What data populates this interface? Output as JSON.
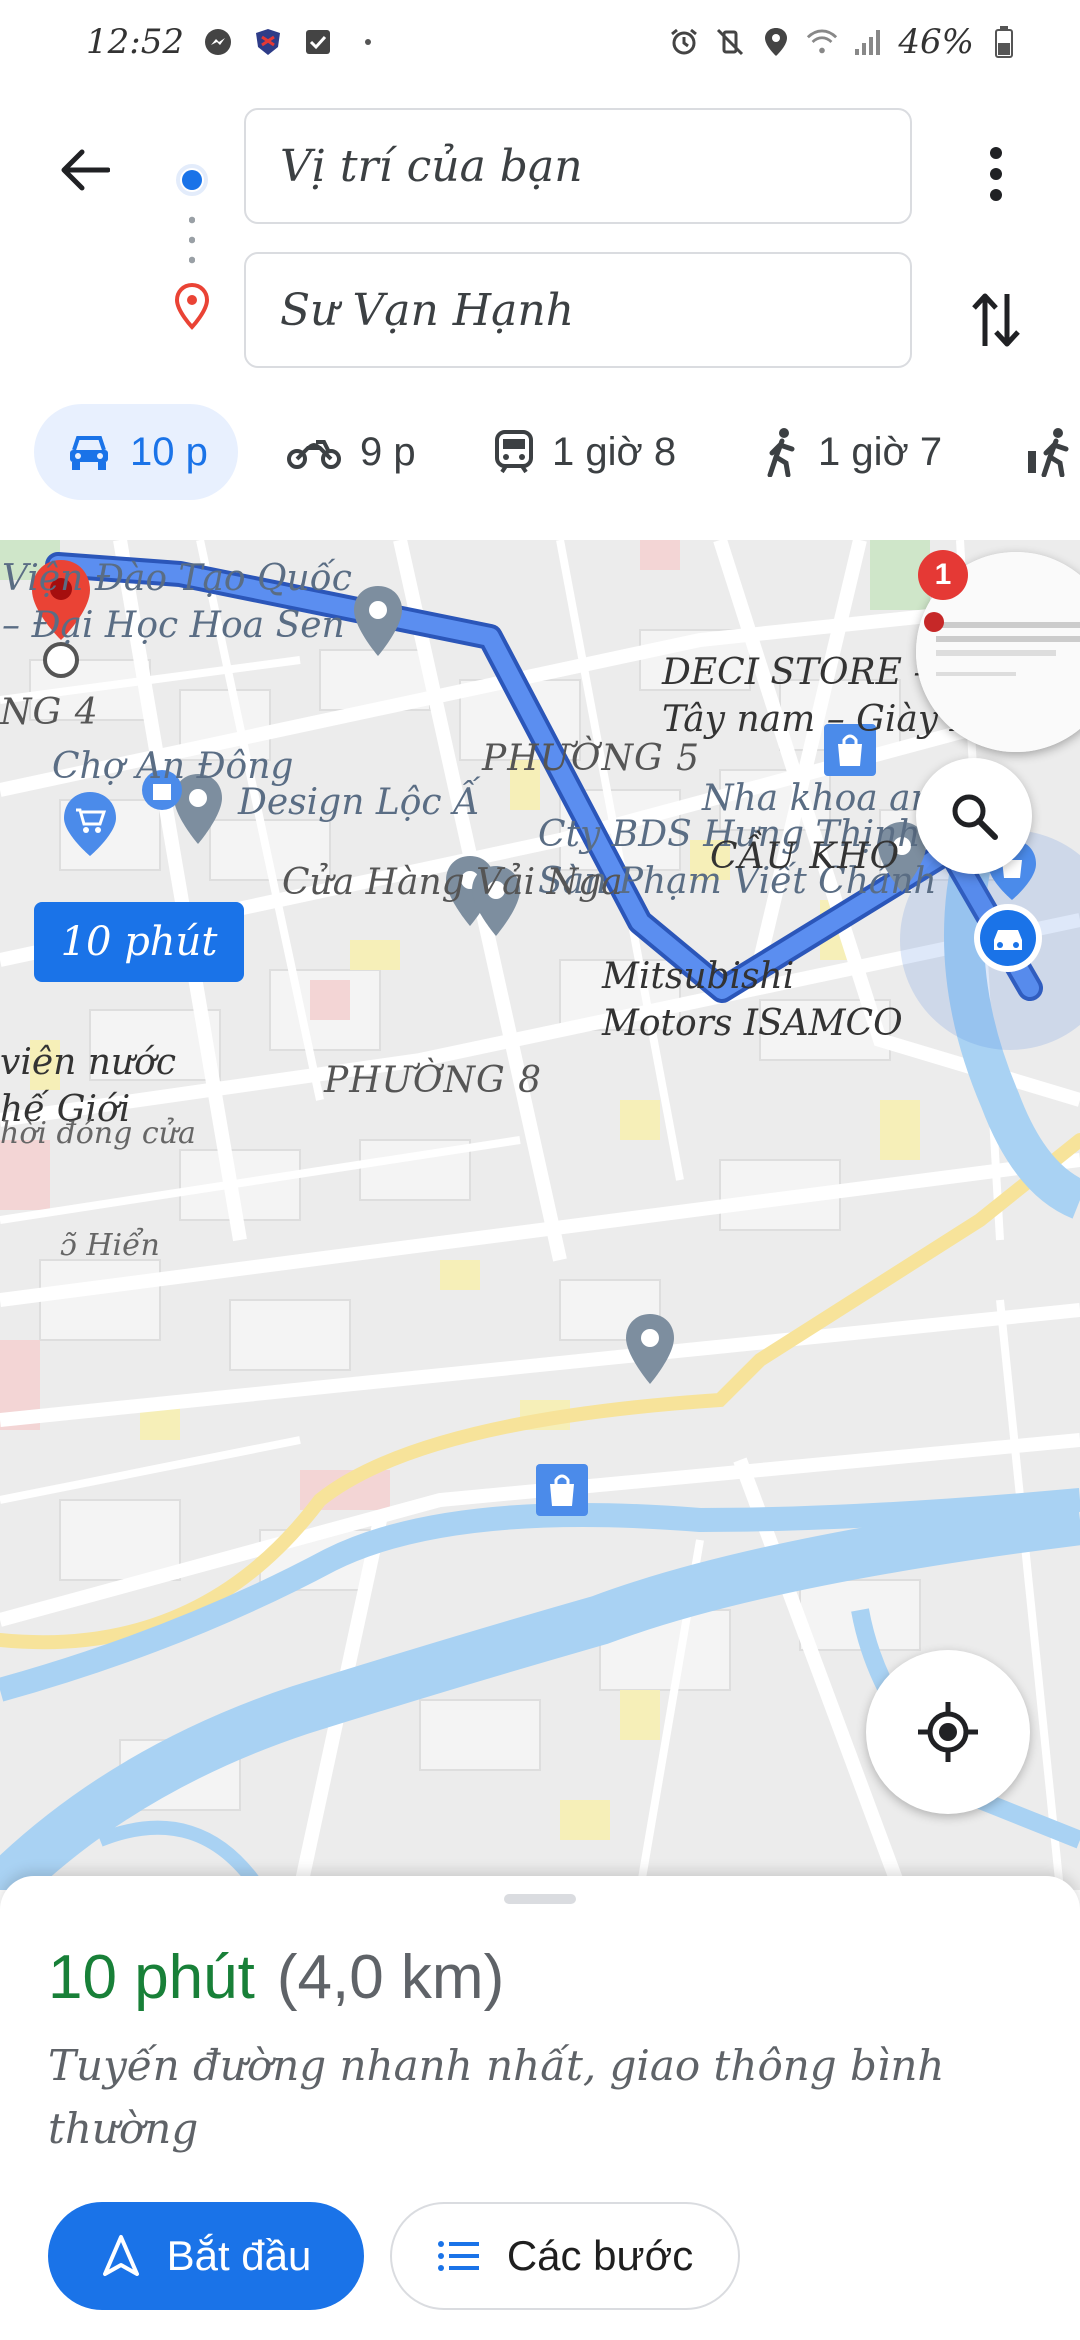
{
  "status_bar": {
    "time": "12:52",
    "battery": "46%"
  },
  "directions": {
    "origin": "Vị trí của bạn",
    "destination": "Sư Vạn Hạnh"
  },
  "modes": [
    {
      "icon": "car-icon",
      "label": "10 p"
    },
    {
      "icon": "motorbike-icon",
      "label": "9 p"
    },
    {
      "icon": "transit-icon",
      "label": "1 giờ 8"
    },
    {
      "icon": "walk-icon",
      "label": "1 giờ 7"
    }
  ],
  "map": {
    "eta_chip": "10 phút",
    "labels": {
      "hoa_sen": "Viện Đào Tạo Quốc\n– Đại Học Hoa Sen",
      "phuong5": "PHƯỜNG 5",
      "design": "Design Lộc Ấ",
      "cty_bds": "Cty BDS Hưng Thịnh–\nSàn Phạm Viết Chánh",
      "deci": "DECI STORE – Giày\nTây nam – Giày Da...",
      "phuong4": "NG 4",
      "cho_an_dong": "Chợ An Đông",
      "nha_khoa": "Nha khoa an",
      "cau_kho": "CẦU KHO",
      "vai_nga": "Cửa Hàng Vải Nga",
      "mitsubishi": "Mitsubishi\nMotors ISAMCO",
      "vien_nuoc": "viên nước\nhế Giới",
      "doi_dong_cua": "hời đóng cửa",
      "phuong8": "PHƯỜNG 8",
      "hien": "ɔ̃ Hiển"
    },
    "notification_count": "1"
  },
  "sheet": {
    "duration": "10 phút",
    "distance": "(4,0 km)",
    "description": "Tuyến đường nhanh nhất, giao thông bình thường",
    "start_label": "Bắt đầu",
    "steps_label": "Các bước"
  },
  "colors": {
    "accent": "#1a73e8",
    "duration_green": "#188038",
    "route_blue": "#4a7fe0",
    "pin_red": "#ea4335"
  }
}
